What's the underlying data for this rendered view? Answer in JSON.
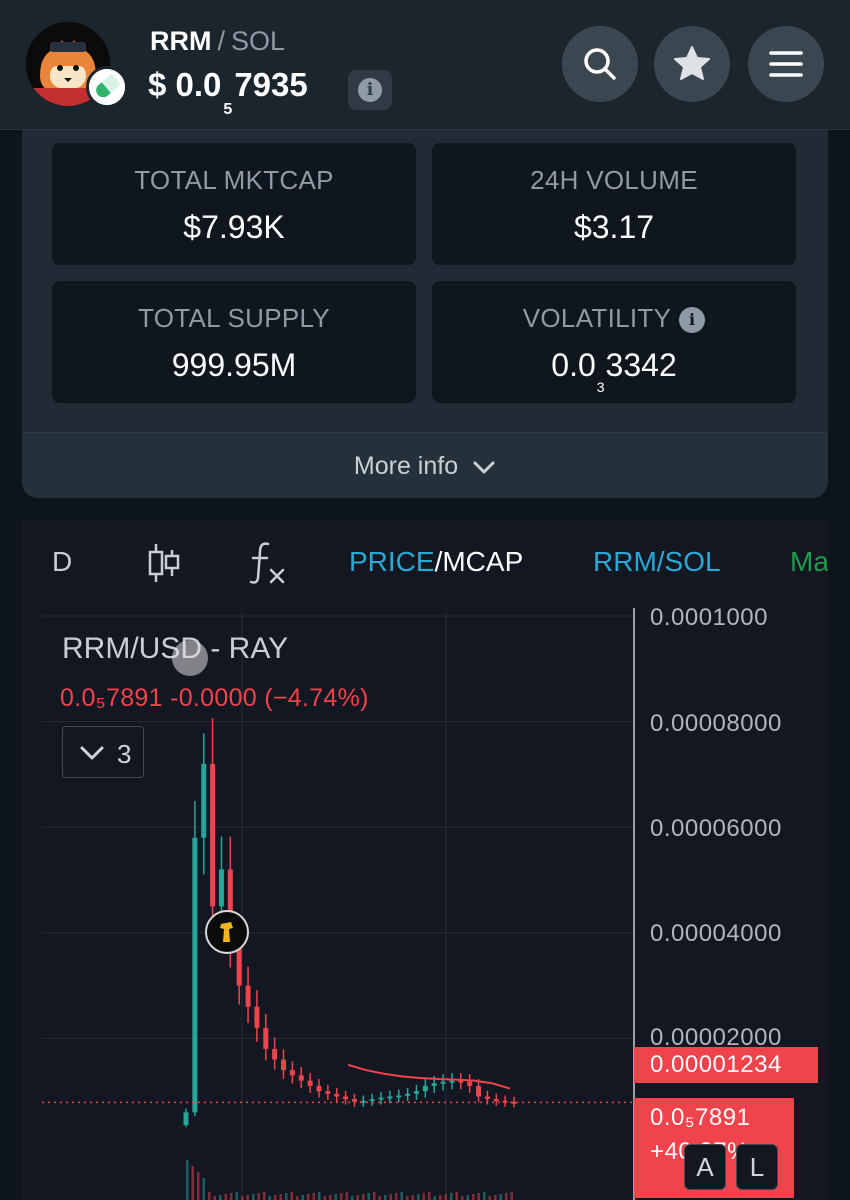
{
  "header": {
    "token_symbol": "RRM",
    "separator": "/",
    "quote_symbol": "SOL",
    "price_prefix": "$",
    "price_lead": "0.0",
    "price_zeros": "5",
    "price_tail": "7935",
    "info_icon": "info-icon",
    "buttons": [
      "search-icon",
      "star-icon",
      "menu-icon"
    ]
  },
  "stats": {
    "mktcap": {
      "label": "TOTAL MKTCAP",
      "value": "$7.93K"
    },
    "volume": {
      "label": "24H VOLUME",
      "value": "$3.17"
    },
    "supply": {
      "label": "TOTAL SUPPLY",
      "value": "999.95M"
    },
    "volatility": {
      "label": "VOLATILITY",
      "value_lead": "0.0",
      "value_zeros": "3",
      "value_tail": "3342"
    },
    "more_info": "More info"
  },
  "chart": {
    "toolbar": {
      "interval": "D",
      "price_label": "PRICE",
      "slash": "/",
      "mcap_label": "MCAP",
      "pair": "RRM/SOL",
      "ma_label": "Ma"
    },
    "legend": {
      "title": "RRM/USD - RAY",
      "ohlc": "0.0₅7891  -0.0000 (−4.74%)",
      "collapse_count": "3"
    },
    "price_axis": [
      "0.0001000",
      "0.00008000",
      "0.00006000",
      "0.00004000",
      "0.00002000"
    ],
    "tags": {
      "upper": "0.00001234",
      "current": "0.0₅7891",
      "change": "+40.37%"
    },
    "scale_buttons": [
      "A",
      "L"
    ],
    "colors": {
      "up": "#26a69a",
      "down": "#f0434b",
      "accent": "#2aa8d6",
      "ma": "#1f9b4d"
    }
  },
  "chart_data": {
    "type": "candlestick",
    "title": "RRM/USD - RAY",
    "ylim": [
      0,
      0.0001
    ],
    "y_ticks": [
      2e-05,
      4e-05,
      6e-05,
      8e-05,
      0.0001
    ],
    "last_price": 7.891e-06,
    "upper_tag": 1.234e-05,
    "change_pct": -4.74,
    "close_series": [
      6e-06,
      5.8e-05,
      7.2e-05,
      4.5e-05,
      5.2e-05,
      3.8e-05,
      3e-05,
      2.6e-05,
      2.2e-05,
      1.8e-05,
      1.6e-05,
      1.4e-05,
      1.3e-05,
      1.2e-05,
      1.1e-05,
      1e-05,
      9.5e-06,
      9e-06,
      8.5e-06,
      8e-06,
      8.2e-06,
      8.5e-06,
      8.8e-06,
      9e-06,
      9.2e-06,
      9.5e-06,
      1e-05,
      1.1e-05,
      1.15e-05,
      1.18e-05,
      1.2e-05,
      1.18e-05,
      1.1e-05,
      9e-06,
      8.5e-06,
      8.2e-06,
      8e-06,
      7.9e-06
    ],
    "ma_series": [
      1.5e-05,
      1.4e-05,
      1.33e-05,
      1.28e-05,
      1.25e-05,
      1.23e-05,
      1.22e-05,
      1.2e-05,
      1.15e-05,
      1.05e-05
    ]
  }
}
